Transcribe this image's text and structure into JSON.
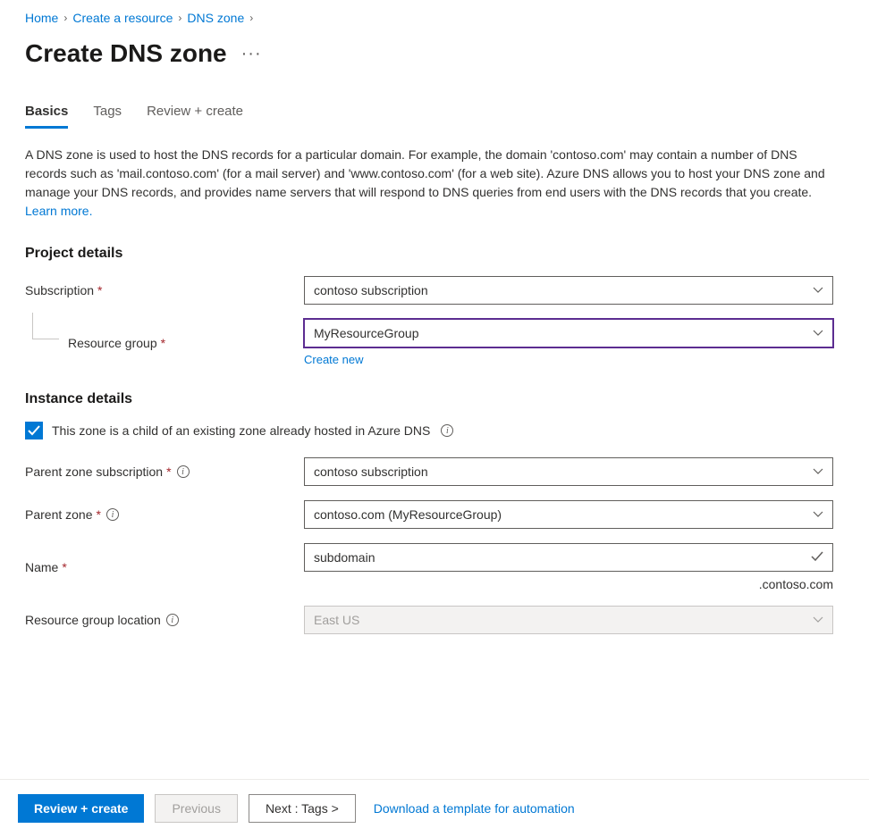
{
  "breadcrumb": {
    "items": [
      "Home",
      "Create a resource",
      "DNS zone"
    ]
  },
  "page_title": "Create DNS zone",
  "tabs": {
    "basics": "Basics",
    "tags": "Tags",
    "review": "Review + create"
  },
  "description": {
    "text": "A DNS zone is used to host the DNS records for a particular domain. For example, the domain 'contoso.com' may contain a number of DNS records such as 'mail.contoso.com' (for a mail server) and 'www.contoso.com' (for a web site). Azure DNS allows you to host your DNS zone and manage your DNS records, and provides name servers that will respond to DNS queries from end users with the DNS records that you create.  ",
    "learn_more": "Learn more."
  },
  "sections": {
    "project_details": "Project details",
    "instance_details": "Instance details"
  },
  "fields": {
    "subscription": {
      "label": "Subscription",
      "value": "contoso subscription"
    },
    "resource_group": {
      "label": "Resource group",
      "value": "MyResourceGroup",
      "create_new": "Create new"
    },
    "child_zone_checkbox": {
      "label": "This zone is a child of an existing zone already hosted in Azure DNS"
    },
    "parent_subscription": {
      "label": "Parent zone subscription",
      "value": "contoso subscription"
    },
    "parent_zone": {
      "label": "Parent zone",
      "value": "contoso.com (MyResourceGroup)"
    },
    "name": {
      "label": "Name",
      "value": "subdomain",
      "suffix": ".contoso.com"
    },
    "location": {
      "label": "Resource group location",
      "value": "East US"
    }
  },
  "footer": {
    "review_create": "Review + create",
    "previous": "Previous",
    "next": "Next : Tags >",
    "download_template": "Download a template for automation"
  }
}
